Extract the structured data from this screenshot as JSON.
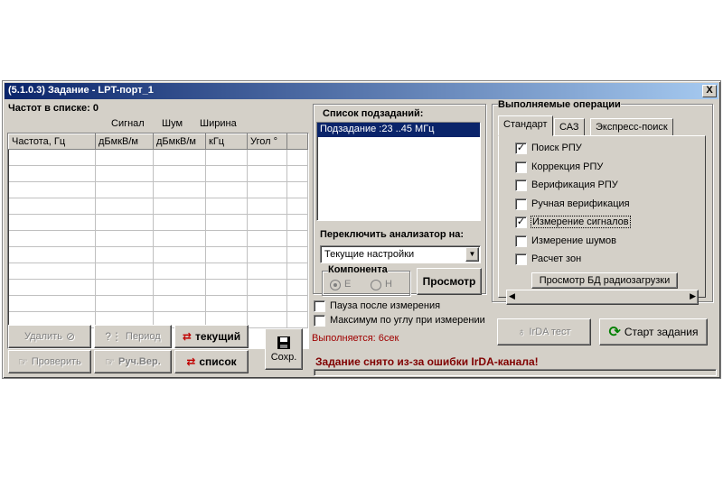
{
  "window": {
    "title": "(5.1.0.3) Задание - LPT-порт_1",
    "close": "X"
  },
  "left": {
    "freq_count": "Частот в списке: 0",
    "col_groups": [
      "Сигнал",
      "Шум",
      "Ширина"
    ],
    "columns": [
      "Частота, Гц",
      "дБмкВ/м",
      "дБмкВ/м",
      "кГц",
      "Угол °"
    ],
    "buttons": {
      "delete": "Удалить",
      "period": "Период",
      "current": "текущий",
      "check": "Проверить",
      "manual": "Руч.Вер.",
      "list": "список",
      "save": "Сохр."
    }
  },
  "middle": {
    "subtasks_title": "Список подзаданий:",
    "subtasks": [
      "Подзадание :23 ..45 МГц"
    ],
    "switch_label": "Переключить анализатор на:",
    "switch_value": "Текущие настройки",
    "component_title": "Компонента",
    "component_options": [
      "E",
      "H"
    ],
    "view_button": "Просмотр",
    "pause_label": "Пауза после измерения",
    "max_label": "Максимум по углу при измерении",
    "running": "Выполняется: 6сек",
    "error": "Задание снято из-за ошибки IrDA-канала!"
  },
  "right": {
    "ops_title": "Выполняемые операции",
    "tabs": [
      "Стандарт",
      "САЗ",
      "Экспресс-поиск"
    ],
    "operations": [
      {
        "label": "Поиск РПУ",
        "checked": true
      },
      {
        "label": "Коррекция РПУ",
        "checked": false
      },
      {
        "label": "Верификация РПУ",
        "checked": false
      },
      {
        "label": "Ручная верификация",
        "checked": false
      },
      {
        "label": "Измерение сигналов",
        "checked": true
      },
      {
        "label": "Измерение шумов",
        "checked": false
      },
      {
        "label": "Расчет зон",
        "checked": false
      }
    ],
    "db_button": "Просмотр БД радиозагрузки",
    "irda_button": "IrDA тест",
    "start_button": "Старт задания"
  },
  "colors": {
    "titlebar": "#0a246a",
    "selection": "#0a246a",
    "error": "#800000",
    "running": "#a00000",
    "face": "#d4d0c8"
  }
}
